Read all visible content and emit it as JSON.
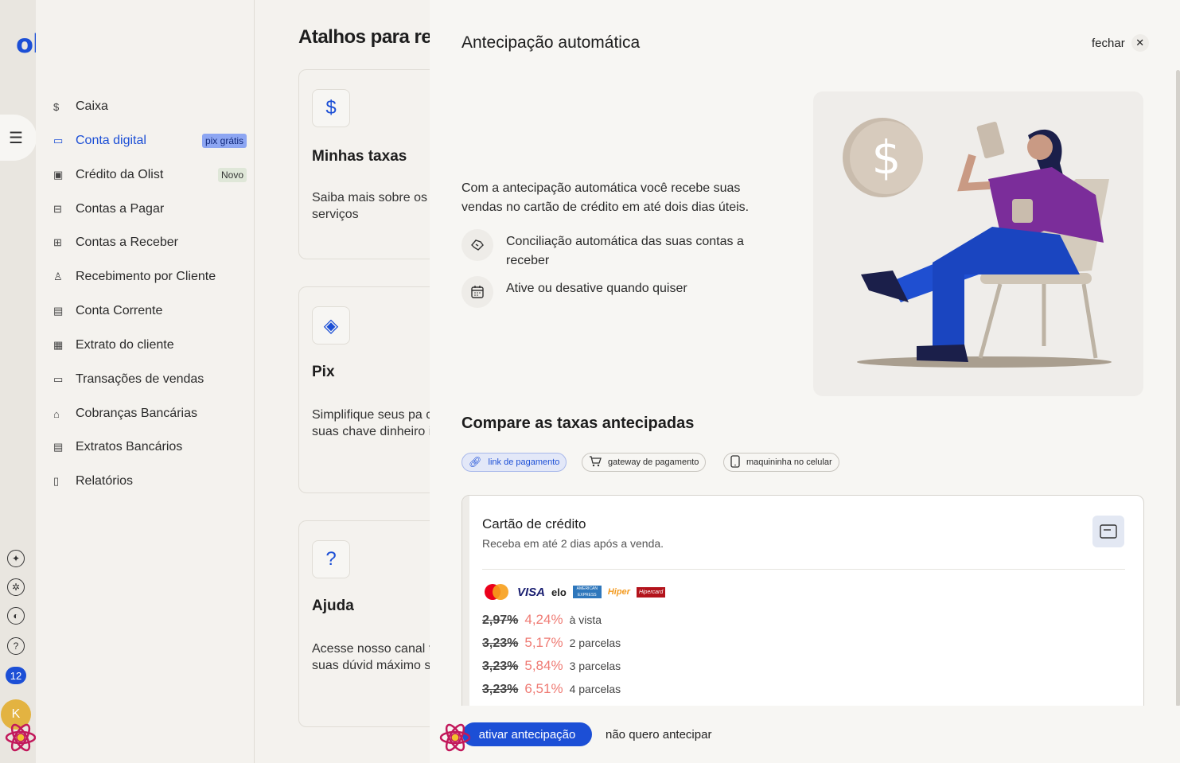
{
  "brand": {
    "logo": "olist",
    "color": "#1c4fd6"
  },
  "sidebar": {
    "items": [
      {
        "icon": "$",
        "label": "Caixa"
      },
      {
        "icon": "▭",
        "label": "Conta digital",
        "tag": "pix grátis"
      },
      {
        "icon": "▣",
        "label": "Crédito da Olist",
        "tag": "Novo"
      },
      {
        "icon": "⊟",
        "label": "Contas a Pagar"
      },
      {
        "icon": "⊞",
        "label": "Contas a Receber"
      },
      {
        "icon": "♙",
        "label": "Recebimento por Cliente"
      },
      {
        "icon": "▤",
        "label": "Conta Corrente"
      },
      {
        "icon": "▦",
        "label": "Extrato do cliente"
      },
      {
        "icon": "▭",
        "label": "Transações de vendas"
      },
      {
        "icon": "⌂",
        "label": "Cobranças Bancárias"
      },
      {
        "icon": "▤",
        "label": "Extratos Bancários"
      },
      {
        "icon": "▯",
        "label": "Relatórios"
      }
    ],
    "notifications": "12",
    "avatar": "K"
  },
  "main": {
    "title": "Atalhos para re",
    "cards": [
      {
        "icon": "$",
        "title": "Minhas taxas",
        "desc": "Saiba mais sobre os dos nossos serviços"
      },
      {
        "icon": "◈",
        "title": "Pix",
        "desc": "Simplifique seus pa cadastre suas chave dinheiro instantanea"
      },
      {
        "icon": "?",
        "title": "Ajuda",
        "desc": "Acesse nosso canal todas as suas dúvid máximo sua conta d"
      }
    ]
  },
  "drawer": {
    "title": "Antecipação automática",
    "close_label": "fechar",
    "intro": "Com a antecipação automática você recebe suas vendas no cartão de crédito em até dois dias úteis.",
    "features": [
      {
        "icon": "handshake-icon",
        "text": "Conciliação automática das suas contas a receber"
      },
      {
        "icon": "calendar-icon",
        "text": "Ative ou desative quando quiser"
      }
    ],
    "compare_title": "Compare as taxas antecipadas",
    "chips": [
      {
        "label": "link de pagamento",
        "icon": "link-icon",
        "active": true
      },
      {
        "label": "gateway de pagamento",
        "icon": "cart-icon",
        "active": false
      },
      {
        "label": "maquininha no celular",
        "icon": "phone-icon",
        "active": false
      }
    ],
    "credit_card": {
      "title": "Cartão de crédito",
      "subtitle": "Receba em até 2 dias após a venda.",
      "brands": [
        "VISA",
        "elo",
        "AMERICAN EXPRESS",
        "Hiper",
        "Hipercard"
      ],
      "rates": [
        {
          "old": "2,97%",
          "new": "4,24%",
          "label": "à vista"
        },
        {
          "old": "3,23%",
          "new": "5,17%",
          "label": "2 parcelas"
        },
        {
          "old": "3,23%",
          "new": "5,84%",
          "label": "3 parcelas"
        },
        {
          "old": "3,23%",
          "new": "6,51%",
          "label": "4 parcelas"
        }
      ]
    },
    "primary_button": "ativar antecipação",
    "secondary_button": "não quero antecipar"
  }
}
